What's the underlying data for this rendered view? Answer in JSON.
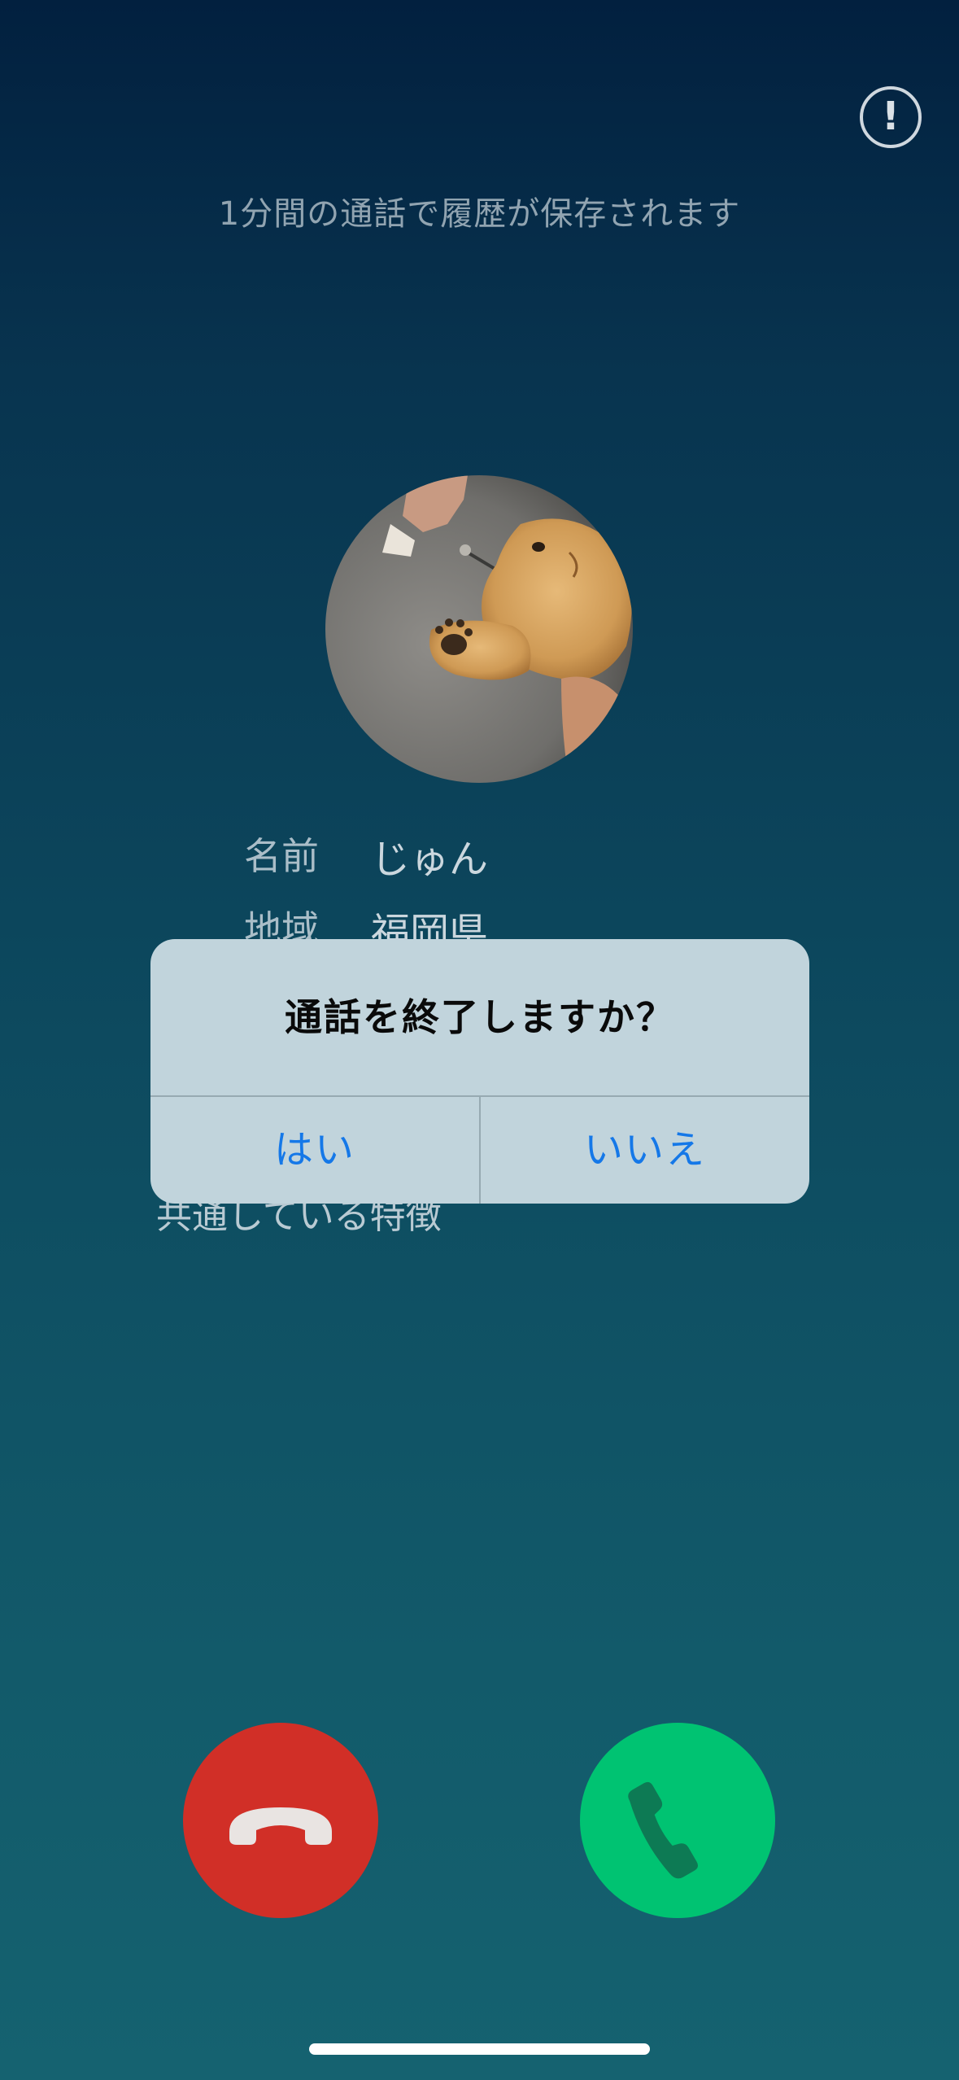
{
  "header": {
    "info_icon": "info-exclamation-icon",
    "info_glyph": "!",
    "save_notice": "1分間の通話で履歴が保存されます"
  },
  "profile": {
    "avatar": "avatar-photo-child-holding-puppy",
    "name_label": "名前",
    "name_value": "じゅん",
    "region_label": "地域",
    "region_value": "福岡県",
    "shared_traits_label": "共通している特徴"
  },
  "dialog": {
    "title": "通話を終了しますか？",
    "yes_label": "はい",
    "no_label": "いいえ"
  },
  "call_controls": {
    "decline_icon": "hang-up-phone-icon",
    "accept_icon": "phone-icon",
    "decline_color": "#d12f27",
    "accept_color": "#00c372"
  },
  "colors": {
    "dialog_background": "#c1d4dc",
    "dialog_button_text": "#1578e8"
  }
}
